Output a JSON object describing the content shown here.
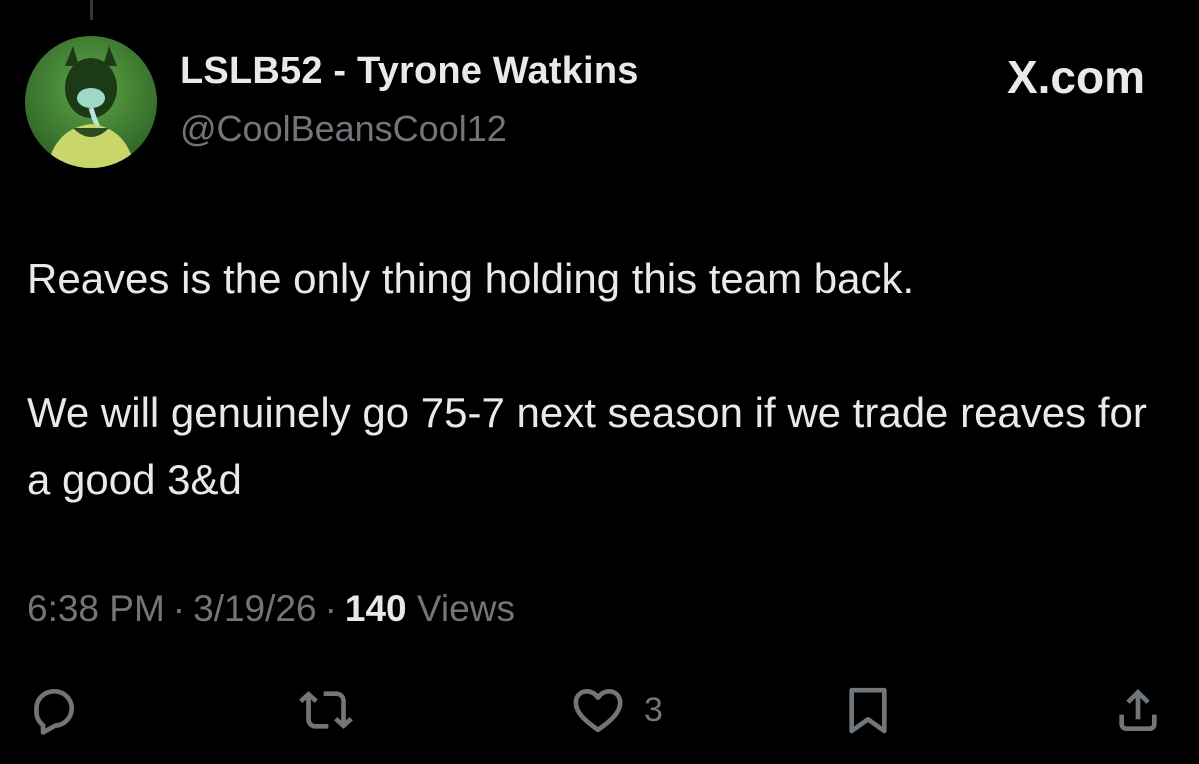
{
  "tweet": {
    "display_name": "LSLB52 - Tyrone Watkins",
    "handle": "@CoolBeansCool12",
    "brand": "X.com",
    "paragraphs": [
      "Reaves is the only thing holding this team back.",
      "We will genuinely go 75-7 next season if we trade reaves for a good 3&d"
    ],
    "time": "6:38 PM",
    "date": "3/19/26",
    "views_count": "140",
    "views_label": "Views",
    "separator": "·"
  },
  "actions": {
    "reply_count": "",
    "retweet_count": "",
    "like_count": "3",
    "bookmark_count": ""
  },
  "icons": {
    "reply": "reply-icon",
    "retweet": "retweet-icon",
    "like": "heart-icon",
    "bookmark": "bookmark-icon",
    "share": "share-icon"
  },
  "colors": {
    "background": "#000000",
    "primary_text": "#e7e9ea",
    "secondary_text": "#71767b",
    "avatar_tint": "#4f9a3f"
  }
}
